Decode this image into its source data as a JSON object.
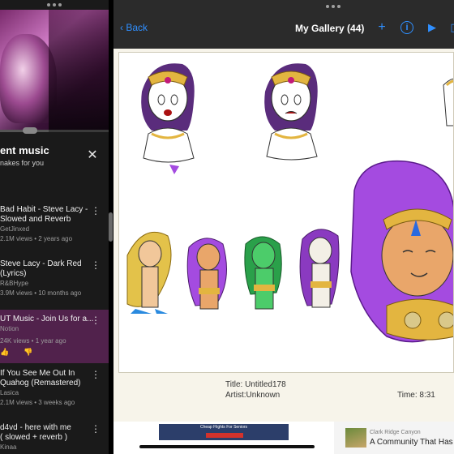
{
  "left_pane": {
    "mix_title": "ent music",
    "mix_subtitle": "nakes for you",
    "videos": [
      {
        "line1": "Bad Habit - Steve Lacy -",
        "line2": "Slowed and Reverb",
        "channel": "GetJinxed",
        "meta": "2.1M views • 2 years ago"
      },
      {
        "line1": "Steve Lacy - Dark Red",
        "line2": "(Lyrics)",
        "channel": "R&BHype",
        "meta": "3.9M views • 10 months ago"
      },
      {
        "line1": "UT Music - Join Us for a...",
        "line2": "",
        "channel": "Notion",
        "meta": "24K views • 1 year ago",
        "highlighted": true
      },
      {
        "line1": "If You See Me Out In",
        "line2": "Quahog (Remastered)",
        "channel": "Lasica",
        "meta": "2.1M views • 3 weeks ago"
      },
      {
        "line1": "d4vd - here with me",
        "line2": "( slowed + reverb )",
        "channel": "Kinaa",
        "meta": ""
      }
    ]
  },
  "gallery": {
    "back_label": "Back",
    "title": "My Gallery (44)",
    "caption_title": "Title: Untitled178",
    "caption_artist": "Artist:Unknown",
    "caption_time": "Time:   8:31"
  },
  "ads": {
    "flight_label": "Cheap Flights For Seniors",
    "home_source": "Clark Ridge Canyon",
    "home_headline": "A Community That Has"
  },
  "colors": {
    "accent": "#2f8fff",
    "highlight_row": "#51224c",
    "hair_purple": "#a44be0",
    "gold": "#e3b540"
  }
}
